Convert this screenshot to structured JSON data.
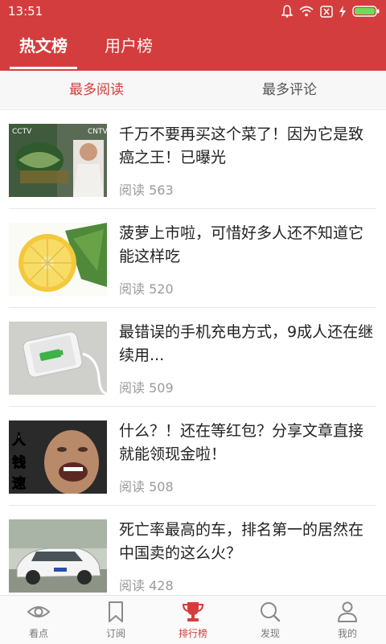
{
  "status_bar": {
    "time": "13:51"
  },
  "header": {
    "tabs": [
      {
        "label": "热文榜",
        "active": true
      },
      {
        "label": "用户榜",
        "active": false
      }
    ]
  },
  "subtabs": [
    {
      "label": "最多阅读",
      "active": true
    },
    {
      "label": "最多评论",
      "active": false
    }
  ],
  "articles": [
    {
      "title": "千万不要再买这个菜了！因为它是致癌之王！已曝光",
      "reads": "阅读 563"
    },
    {
      "title": "菠萝上市啦，可惜好多人还不知道它能这样吃",
      "reads": "阅读 520"
    },
    {
      "title": "最错误的手机充电方式，9成人还在继续用...",
      "reads": "阅读 509"
    },
    {
      "title": "什么？！还在等红包？分享文章直接就能领现金啦！",
      "reads": "阅读 508"
    },
    {
      "title": "死亡率最高的车，排名第一的居然在中国卖的这么火？",
      "reads": "阅读 428"
    }
  ],
  "bottom_nav": [
    {
      "label": "看点",
      "icon": "eye-icon"
    },
    {
      "label": "订阅",
      "icon": "bookmark-icon"
    },
    {
      "label": "排行榜",
      "icon": "trophy-icon",
      "active": true
    },
    {
      "label": "发现",
      "icon": "search-icon"
    },
    {
      "label": "我的",
      "icon": "user-icon"
    }
  ],
  "colors": {
    "accent": "#d43d3d",
    "text": "#222222",
    "muted": "#9a9a9a"
  }
}
